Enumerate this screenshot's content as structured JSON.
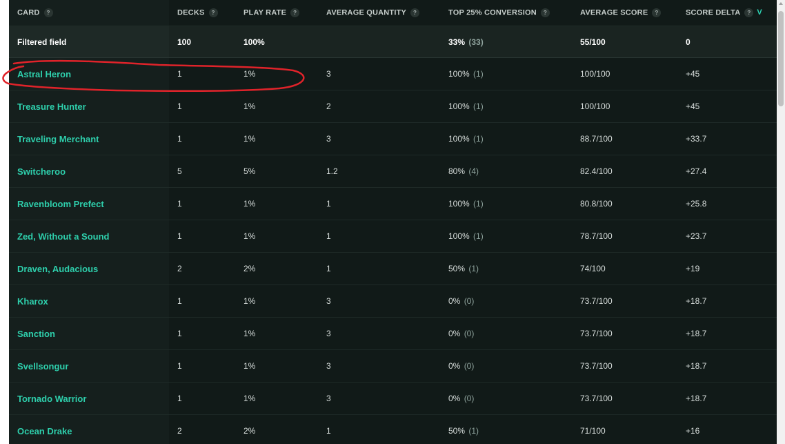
{
  "table": {
    "columns": [
      {
        "label": "CARD",
        "help": "?"
      },
      {
        "label": "DECKS",
        "help": "?"
      },
      {
        "label": "PLAY RATE",
        "help": "?"
      },
      {
        "label": "AVERAGE QUANTITY",
        "help": "?"
      },
      {
        "label": "TOP 25% CONVERSION",
        "help": "?"
      },
      {
        "label": "AVERAGE SCORE",
        "help": "?"
      },
      {
        "label": "SCORE DELTA",
        "help": "?",
        "sort": "V"
      }
    ],
    "filtered": {
      "card": "Filtered field",
      "decks": "100",
      "play_rate": "100%",
      "avg_qty": "",
      "conversion": "33%",
      "conversion_count": "(33)",
      "avg_score": "55/100",
      "delta": "0"
    },
    "rows": [
      {
        "card": "Astral Heron",
        "decks": "1",
        "play_rate": "1%",
        "avg_qty": "3",
        "conversion": "100%",
        "conversion_count": "(1)",
        "avg_score": "100/100",
        "delta": "+45"
      },
      {
        "card": "Treasure Hunter",
        "decks": "1",
        "play_rate": "1%",
        "avg_qty": "2",
        "conversion": "100%",
        "conversion_count": "(1)",
        "avg_score": "100/100",
        "delta": "+45"
      },
      {
        "card": "Traveling Merchant",
        "decks": "1",
        "play_rate": "1%",
        "avg_qty": "3",
        "conversion": "100%",
        "conversion_count": "(1)",
        "avg_score": "88.7/100",
        "delta": "+33.7"
      },
      {
        "card": "Switcheroo",
        "decks": "5",
        "play_rate": "5%",
        "avg_qty": "1.2",
        "conversion": "80%",
        "conversion_count": "(4)",
        "avg_score": "82.4/100",
        "delta": "+27.4"
      },
      {
        "card": "Ravenbloom Prefect",
        "decks": "1",
        "play_rate": "1%",
        "avg_qty": "1",
        "conversion": "100%",
        "conversion_count": "(1)",
        "avg_score": "80.8/100",
        "delta": "+25.8"
      },
      {
        "card": "Zed, Without a Sound",
        "decks": "1",
        "play_rate": "1%",
        "avg_qty": "1",
        "conversion": "100%",
        "conversion_count": "(1)",
        "avg_score": "78.7/100",
        "delta": "+23.7"
      },
      {
        "card": "Draven, Audacious",
        "decks": "2",
        "play_rate": "2%",
        "avg_qty": "1",
        "conversion": "50%",
        "conversion_count": "(1)",
        "avg_score": "74/100",
        "delta": "+19"
      },
      {
        "card": "Kharox",
        "decks": "1",
        "play_rate": "1%",
        "avg_qty": "3",
        "conversion": "0%",
        "conversion_count": "(0)",
        "avg_score": "73.7/100",
        "delta": "+18.7"
      },
      {
        "card": "Sanction",
        "decks": "1",
        "play_rate": "1%",
        "avg_qty": "3",
        "conversion": "0%",
        "conversion_count": "(0)",
        "avg_score": "73.7/100",
        "delta": "+18.7"
      },
      {
        "card": "Svellsongur",
        "decks": "1",
        "play_rate": "1%",
        "avg_qty": "3",
        "conversion": "0%",
        "conversion_count": "(0)",
        "avg_score": "73.7/100",
        "delta": "+18.7"
      },
      {
        "card": "Tornado Warrior",
        "decks": "1",
        "play_rate": "1%",
        "avg_qty": "3",
        "conversion": "0%",
        "conversion_count": "(0)",
        "avg_score": "73.7/100",
        "delta": "+18.7"
      },
      {
        "card": "Ocean Drake",
        "decks": "2",
        "play_rate": "2%",
        "avg_qty": "1",
        "conversion": "50%",
        "conversion_count": "(1)",
        "avg_score": "71/100",
        "delta": "+16"
      }
    ]
  },
  "colors": {
    "background": "#111a18",
    "card_link": "#2ecfac",
    "sort_indicator": "#2dd4b4",
    "annotation_circle": "#e0232a"
  },
  "annotation": {
    "type": "hand-drawn-circle",
    "target": "Astral Heron"
  }
}
